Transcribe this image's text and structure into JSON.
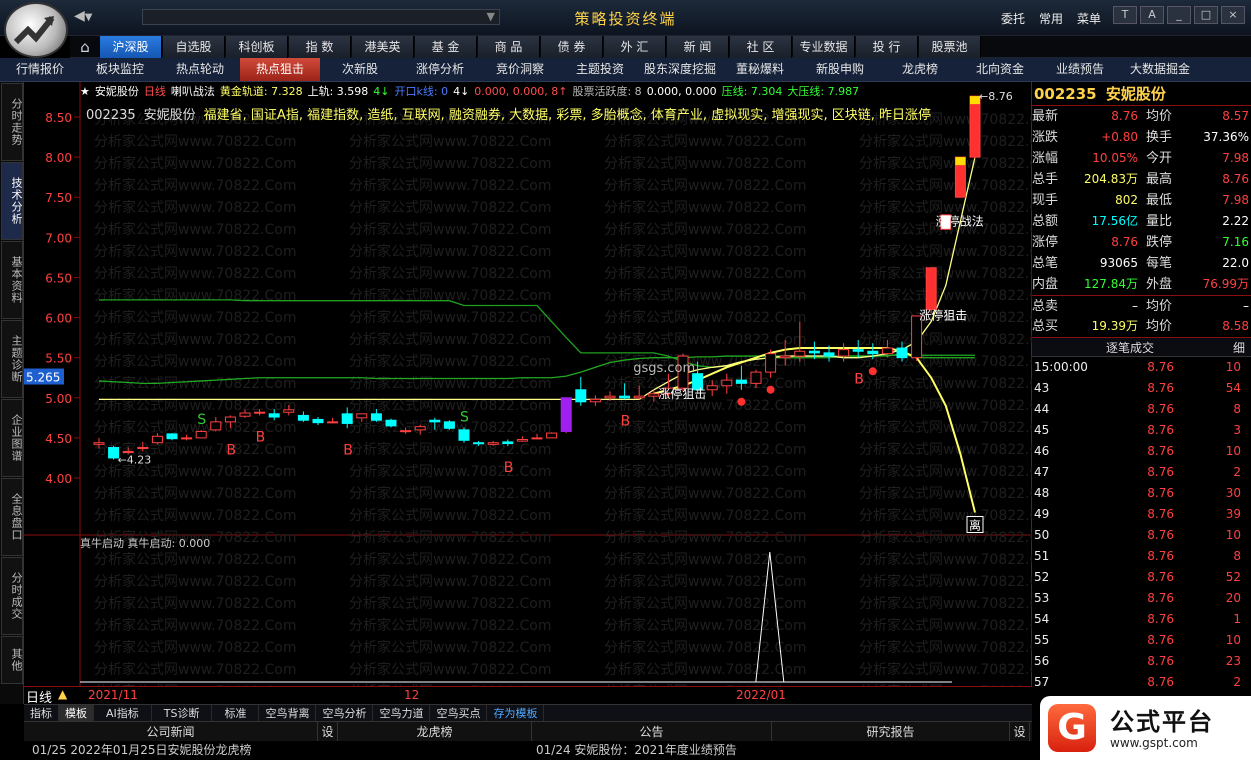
{
  "window": {
    "title": "策略投资终端",
    "top_right_links": [
      "委托",
      "常用",
      "菜单"
    ],
    "win_buttons": [
      "T",
      "A",
      "_",
      "□",
      "×"
    ]
  },
  "menubar": {
    "home_icon": "home-icon",
    "items": [
      "沪深股",
      "自选股",
      "科创板",
      "指 数",
      "港美英",
      "基 金",
      "商 品",
      "债 券",
      "外 汇",
      "新 闻",
      "社 区",
      "专业数据",
      "投 行",
      "股票池"
    ],
    "active_index": 0
  },
  "subnav": {
    "items": [
      "行情报价",
      "板块监控",
      "热点轮动",
      "热点狙击",
      "次新股",
      "涨停分析",
      "竞价洞察",
      "主题投资",
      "股东深度挖掘",
      "董秘爆料",
      "新股申购",
      "龙虎榜",
      "北向资金",
      "业绩预告",
      "大数据掘金"
    ],
    "active_index": 3
  },
  "left_tabs": [
    "分时走势",
    "技术分析",
    "基本资料",
    "主题诊断",
    "企业图谱",
    "全息盘口",
    "分时成交",
    "其他"
  ],
  "left_tabs_active": 1,
  "chart": {
    "info_line": [
      {
        "text": "★",
        "color": "#ffffff"
      },
      {
        "text": "安妮股份",
        "color": "#ffffff"
      },
      {
        "text": "日线",
        "color": "#ff4d4d"
      },
      {
        "text": "喇叭战法",
        "color": "#ffffff"
      },
      {
        "text": "黄金轨道: 7.328",
        "color": "#ffff66"
      },
      {
        "text": "上轨: 3.598",
        "color": "#ffffff"
      },
      {
        "text": "4↓",
        "color": "#33ff33"
      },
      {
        "text": "开口k线: 0",
        "color": "#4d7bff"
      },
      {
        "text": "4↓",
        "color": "#ffffff"
      },
      {
        "text": "0.000, 0.000, 8↑",
        "color": "#ff4d4d"
      },
      {
        "text": "股票活跃度: 8",
        "color": "#bbbbbb"
      },
      {
        "text": "0.000, 0.000",
        "color": "#ffffff"
      },
      {
        "text": "压线: 7.304",
        "color": "#33ff33"
      },
      {
        "text": "大压线: 7.987",
        "color": "#33ff33"
      }
    ],
    "title_line": [
      {
        "text": "002235",
        "color": "#dddddd"
      },
      {
        "text": "安妮股份",
        "color": "#dddddd"
      },
      {
        "text": "福建省, 国证A指, 福建指数, 造纸, 互联网, 融资融券, 大数据, 彩票, 多胎概念, 体育产业, 虚拟现实, 增强现实, 区块链, 昨日涨停",
        "color": "#ffff66"
      }
    ],
    "price_axis": [
      "8.50",
      "8.00",
      "7.50",
      "7.00",
      "6.50",
      "6.00",
      "5.50",
      "5.00",
      "4.50",
      "4.00"
    ],
    "cursor_price": "5.265",
    "watermark": "分析家公式网www.70822.Com",
    "labels": {
      "low": "4.23",
      "high": "8.76",
      "zt_zhanfa": "涨停战法",
      "zt_juji": "涨停狙击",
      "zt_juji2": "涨停狙击",
      "site": "gsgs.com",
      "end_tag": "离"
    },
    "indicator_line": "真牛启动  真牛启动: 0.000",
    "date_axis": [
      "2021/11",
      "12",
      "2022/01"
    ],
    "period_label": "日线"
  },
  "chart_data": {
    "type": "candlestick",
    "title": "安妮股份 日线",
    "symbol": "002235",
    "y_range": [
      3.8,
      8.8
    ],
    "y_ticks": [
      4.0,
      4.5,
      5.0,
      5.5,
      6.0,
      6.5,
      7.0,
      7.5,
      8.0,
      8.5
    ],
    "x_ticks": [
      "2021/11",
      "12",
      "2022/01"
    ],
    "candles": [
      {
        "o": 4.42,
        "h": 4.5,
        "l": 4.37,
        "c": 4.44
      },
      {
        "o": 4.38,
        "h": 4.4,
        "l": 4.23,
        "c": 4.25
      },
      {
        "o": 4.33,
        "h": 4.38,
        "l": 4.3,
        "c": 4.33
      },
      {
        "o": 4.37,
        "h": 4.45,
        "l": 4.33,
        "c": 4.38
      },
      {
        "o": 4.44,
        "h": 4.56,
        "l": 4.42,
        "c": 4.52
      },
      {
        "o": 4.55,
        "h": 4.56,
        "l": 4.47,
        "c": 4.49
      },
      {
        "o": 4.5,
        "h": 4.54,
        "l": 4.47,
        "c": 4.5
      },
      {
        "o": 4.5,
        "h": 4.6,
        "l": 4.5,
        "c": 4.58
      },
      {
        "o": 4.6,
        "h": 4.76,
        "l": 4.58,
        "c": 4.7
      },
      {
        "o": 4.7,
        "h": 4.78,
        "l": 4.62,
        "c": 4.76
      },
      {
        "o": 4.77,
        "h": 4.85,
        "l": 4.75,
        "c": 4.81
      },
      {
        "o": 4.82,
        "h": 4.86,
        "l": 4.78,
        "c": 4.82
      },
      {
        "o": 4.8,
        "h": 4.86,
        "l": 4.72,
        "c": 4.76
      },
      {
        "o": 4.82,
        "h": 4.91,
        "l": 4.78,
        "c": 4.85
      },
      {
        "o": 4.78,
        "h": 4.83,
        "l": 4.7,
        "c": 4.72
      },
      {
        "o": 4.73,
        "h": 4.76,
        "l": 4.66,
        "c": 4.69
      },
      {
        "o": 4.7,
        "h": 4.75,
        "l": 4.68,
        "c": 4.7
      },
      {
        "o": 4.8,
        "h": 4.88,
        "l": 4.62,
        "c": 4.68
      },
      {
        "o": 4.75,
        "h": 4.8,
        "l": 4.7,
        "c": 4.8
      },
      {
        "o": 4.8,
        "h": 4.86,
        "l": 4.7,
        "c": 4.72
      },
      {
        "o": 4.72,
        "h": 4.74,
        "l": 4.63,
        "c": 4.65
      },
      {
        "o": 4.58,
        "h": 4.63,
        "l": 4.55,
        "c": 4.59
      },
      {
        "o": 4.6,
        "h": 4.66,
        "l": 4.54,
        "c": 4.64
      },
      {
        "o": 4.72,
        "h": 4.75,
        "l": 4.6,
        "c": 4.7
      },
      {
        "o": 4.7,
        "h": 4.72,
        "l": 4.6,
        "c": 4.62
      },
      {
        "o": 4.6,
        "h": 4.63,
        "l": 4.44,
        "c": 4.47
      },
      {
        "o": 4.44,
        "h": 4.46,
        "l": 4.4,
        "c": 4.43
      },
      {
        "o": 4.42,
        "h": 4.46,
        "l": 4.4,
        "c": 4.44
      },
      {
        "o": 4.45,
        "h": 4.48,
        "l": 4.4,
        "c": 4.43
      },
      {
        "o": 4.46,
        "h": 4.52,
        "l": 4.45,
        "c": 4.48
      },
      {
        "o": 4.5,
        "h": 4.55,
        "l": 4.48,
        "c": 4.5
      },
      {
        "o": 4.5,
        "h": 4.57,
        "l": 4.5,
        "c": 4.56
      },
      {
        "o": 4.58,
        "h": 5.0,
        "l": 4.56,
        "c": 5.0
      },
      {
        "o": 5.1,
        "h": 5.26,
        "l": 4.9,
        "c": 4.95
      },
      {
        "o": 4.95,
        "h": 5.03,
        "l": 4.9,
        "c": 4.98
      },
      {
        "o": 5.0,
        "h": 5.08,
        "l": 4.96,
        "c": 5.02
      },
      {
        "o": 5.02,
        "h": 5.18,
        "l": 4.98,
        "c": 5.0
      },
      {
        "o": 5.0,
        "h": 5.15,
        "l": 4.98,
        "c": 5.02
      },
      {
        "o": 5.02,
        "h": 5.1,
        "l": 4.95,
        "c": 5.05
      },
      {
        "o": 5.05,
        "h": 5.3,
        "l": 5.0,
        "c": 5.12
      },
      {
        "o": 5.12,
        "h": 5.55,
        "l": 5.08,
        "c": 5.52
      },
      {
        "o": 5.3,
        "h": 5.45,
        "l": 5.05,
        "c": 5.1
      },
      {
        "o": 5.1,
        "h": 5.22,
        "l": 5.02,
        "c": 5.15
      },
      {
        "o": 5.15,
        "h": 5.3,
        "l": 5.05,
        "c": 5.22
      },
      {
        "o": 5.22,
        "h": 5.4,
        "l": 5.1,
        "c": 5.18
      },
      {
        "o": 5.18,
        "h": 5.35,
        "l": 5.12,
        "c": 5.32
      },
      {
        "o": 5.32,
        "h": 5.6,
        "l": 5.25,
        "c": 5.55
      },
      {
        "o": 5.5,
        "h": 5.72,
        "l": 5.4,
        "c": 5.52
      },
      {
        "o": 5.52,
        "h": 5.95,
        "l": 5.45,
        "c": 5.58
      },
      {
        "o": 5.58,
        "h": 5.7,
        "l": 5.48,
        "c": 5.56
      },
      {
        "o": 5.56,
        "h": 5.65,
        "l": 5.45,
        "c": 5.52
      },
      {
        "o": 5.52,
        "h": 5.68,
        "l": 5.45,
        "c": 5.6
      },
      {
        "o": 5.6,
        "h": 5.72,
        "l": 5.5,
        "c": 5.58
      },
      {
        "o": 5.58,
        "h": 5.68,
        "l": 5.48,
        "c": 5.55
      },
      {
        "o": 5.55,
        "h": 5.72,
        "l": 5.5,
        "c": 5.62
      },
      {
        "o": 5.62,
        "h": 5.7,
        "l": 5.45,
        "c": 5.5
      },
      {
        "o": 5.5,
        "h": 6.02,
        "l": 5.46,
        "c": 6.02
      },
      {
        "o": 6.1,
        "h": 6.62,
        "l": 6.05,
        "c": 6.62
      },
      {
        "o": 7.1,
        "h": 7.28,
        "l": 7.1,
        "c": 7.28
      },
      {
        "o": 7.5,
        "h": 8.0,
        "l": 7.5,
        "c": 8.0
      },
      {
        "o": 8.0,
        "h": 8.76,
        "l": 7.98,
        "c": 8.76
      }
    ],
    "series": [
      {
        "name": "黄金轨道",
        "values": [
          6.22,
          6.22,
          6.22,
          6.22,
          6.22,
          6.22,
          6.22,
          6.22,
          6.22,
          6.22,
          6.21,
          6.21,
          6.21,
          6.21,
          6.21,
          6.21,
          6.21,
          6.21,
          6.21,
          6.21,
          6.21,
          6.21,
          6.21,
          6.21,
          6.21,
          6.15,
          6.15,
          6.15,
          6.15,
          6.15,
          6.15,
          5.95,
          5.75,
          5.56,
          5.56,
          5.56,
          5.56,
          5.56,
          5.56,
          5.52,
          5.45,
          5.4,
          5.38,
          5.4,
          5.45,
          5.48,
          5.5,
          5.5,
          5.5,
          5.5,
          5.5,
          5.52,
          5.52,
          5.52,
          5.52,
          5.55,
          5.5,
          5.5,
          5.5,
          5.5,
          5.5
        ]
      },
      {
        "name": "中轨",
        "values": [
          5.21,
          5.2,
          5.19,
          5.18,
          5.18,
          5.19,
          5.2,
          5.21,
          5.22,
          5.23,
          5.24,
          5.25,
          5.25,
          5.25,
          5.25,
          5.25,
          5.25,
          5.25,
          5.25,
          5.24,
          5.24,
          5.24,
          5.24,
          5.24,
          5.24,
          5.24,
          5.24,
          5.24,
          5.24,
          5.25,
          5.25,
          5.25,
          5.27,
          5.32,
          5.38,
          5.44,
          5.47,
          5.49,
          5.5,
          5.5,
          5.5,
          5.51,
          5.51,
          5.52,
          5.52,
          5.52,
          5.52,
          5.52,
          5.52,
          5.52,
          5.52,
          5.52,
          5.52,
          5.52,
          5.53,
          5.53,
          5.53,
          5.53,
          5.53,
          5.53,
          5.53
        ]
      },
      {
        "name": "下轨",
        "values": [
          4.98,
          4.98,
          4.98,
          4.98,
          4.98,
          4.98,
          4.98,
          4.98,
          4.98,
          4.98,
          4.98,
          4.98,
          4.98,
          4.98,
          4.98,
          4.98,
          4.98,
          4.98,
          4.98,
          4.98,
          4.98,
          4.98,
          4.98,
          4.98,
          4.98,
          4.98,
          4.98,
          4.98,
          4.98,
          4.98,
          4.98,
          4.98,
          4.98,
          4.98,
          4.98,
          4.98,
          4.98,
          4.98,
          5.1,
          5.2,
          5.3,
          5.35,
          5.38,
          5.4,
          5.45,
          5.48,
          5.5,
          5.52,
          5.52,
          5.52,
          5.52,
          5.5,
          5.5,
          5.52,
          5.55,
          5.6,
          5.7,
          5.95,
          6.4,
          7.2,
          8.0
        ]
      },
      {
        "name": "上轨",
        "values": [
          null,
          null,
          null,
          null,
          null,
          null,
          null,
          null,
          null,
          null,
          null,
          null,
          null,
          null,
          null,
          null,
          null,
          null,
          null,
          null,
          null,
          null,
          null,
          null,
          null,
          null,
          null,
          null,
          null,
          null,
          null,
          null,
          null,
          null,
          null,
          null,
          null,
          null,
          5.05,
          5.1,
          5.15,
          5.22,
          5.3,
          5.38,
          5.44,
          5.5,
          5.56,
          5.6,
          5.62,
          5.62,
          5.62,
          5.62,
          5.62,
          5.62,
          5.62,
          5.58,
          5.5,
          5.25,
          4.9,
          4.3,
          3.57
        ]
      }
    ],
    "markers": {
      "B": [
        9,
        11,
        17,
        28,
        36,
        52
      ],
      "S": [
        7,
        25
      ],
      "red_dots": [
        44,
        46,
        53
      ]
    },
    "indicator": {
      "name": "真牛启动",
      "value": 0.0,
      "spikes": [
        {
          "index": 38,
          "value": 1.0
        }
      ]
    }
  },
  "quote": {
    "code": "002235",
    "name": "安妮股份",
    "rows": [
      {
        "l": "最新",
        "lv": "8.76",
        "lc": "#ff4040",
        "r": "均价",
        "rv": "8.57",
        "rc": "#ff4040"
      },
      {
        "l": "涨跌",
        "lv": "+0.80",
        "lc": "#ff4040",
        "r": "换手",
        "rv": "37.36%",
        "rc": "#ffffff"
      },
      {
        "l": "涨幅",
        "lv": "10.05%",
        "lc": "#ff4040",
        "r": "今开",
        "rv": "7.98",
        "rc": "#ff4040"
      },
      {
        "l": "总手",
        "lv": "204.83万",
        "lc": "#ffff66",
        "r": "最高",
        "rv": "8.76",
        "rc": "#ff4040"
      },
      {
        "l": "现手",
        "lv": "802",
        "lc": "#ffff66",
        "r": "最低",
        "rv": "7.98",
        "rc": "#ff4040"
      },
      {
        "l": "总额",
        "lv": "17.56亿",
        "lc": "#00ffff",
        "r": "量比",
        "rv": "2.22",
        "rc": "#ffffff"
      },
      {
        "l": "涨停",
        "lv": "8.76",
        "lc": "#ff4040",
        "r": "跌停",
        "rv": "7.16",
        "rc": "#33ff33"
      },
      {
        "l": "总笔",
        "lv": "93065",
        "lc": "#ffffff",
        "r": "每笔",
        "rv": "22.0",
        "rc": "#ffffff"
      },
      {
        "l": "内盘",
        "lv": "127.84万",
        "lc": "#33ff33",
        "r": "外盘",
        "rv": "76.99万",
        "rc": "#ff4040"
      },
      {
        "l": "总卖",
        "lv": "–",
        "lc": "#ffffff",
        "r": "均价",
        "rv": "–",
        "rc": "#ffffff"
      },
      {
        "l": "总买",
        "lv": "19.39万",
        "lc": "#ffff66",
        "r": "均价",
        "rv": "8.58",
        "rc": "#ff4040"
      }
    ]
  },
  "trades": {
    "header": "逐笔成交",
    "toggle": "细",
    "rows": [
      {
        "t": "15:00:00",
        "p": "8.76",
        "v": "10"
      },
      {
        "t": "43",
        "p": "8.76",
        "v": "54"
      },
      {
        "t": "44",
        "p": "8.76",
        "v": "8"
      },
      {
        "t": "45",
        "p": "8.76",
        "v": "3"
      },
      {
        "t": "46",
        "p": "8.76",
        "v": "10"
      },
      {
        "t": "47",
        "p": "8.76",
        "v": "2"
      },
      {
        "t": "48",
        "p": "8.76",
        "v": "30"
      },
      {
        "t": "49",
        "p": "8.76",
        "v": "39"
      },
      {
        "t": "50",
        "p": "8.76",
        "v": "10"
      },
      {
        "t": "51",
        "p": "8.76",
        "v": "8"
      },
      {
        "t": "52",
        "p": "8.76",
        "v": "52"
      },
      {
        "t": "53",
        "p": "8.76",
        "v": "20"
      },
      {
        "t": "54",
        "p": "8.76",
        "v": "1"
      },
      {
        "t": "55",
        "p": "8.76",
        "v": "10"
      },
      {
        "t": "56",
        "p": "8.76",
        "v": "23"
      },
      {
        "t": "57",
        "p": "8.76",
        "v": "2"
      }
    ]
  },
  "bottom_tabs": [
    "指标",
    "模板",
    "AI指标",
    "TS诊断",
    "标准",
    "空鸟背离",
    "空鸟分析",
    "空鸟力道",
    "空鸟买点",
    "存为模板"
  ],
  "bottom_tabs_active": 1,
  "news_bar": {
    "cols": [
      "公司新闻",
      "设",
      "龙虎榜",
      "公告",
      "研究报告",
      "设"
    ]
  },
  "news_list": [
    "01/25  2022年01月25日安妮股份龙虎榜",
    "01/24  安妮股份：2021年度业绩预告"
  ],
  "brand": {
    "name": "公式平台",
    "url": "www.gspt.com",
    "mark": "G"
  }
}
